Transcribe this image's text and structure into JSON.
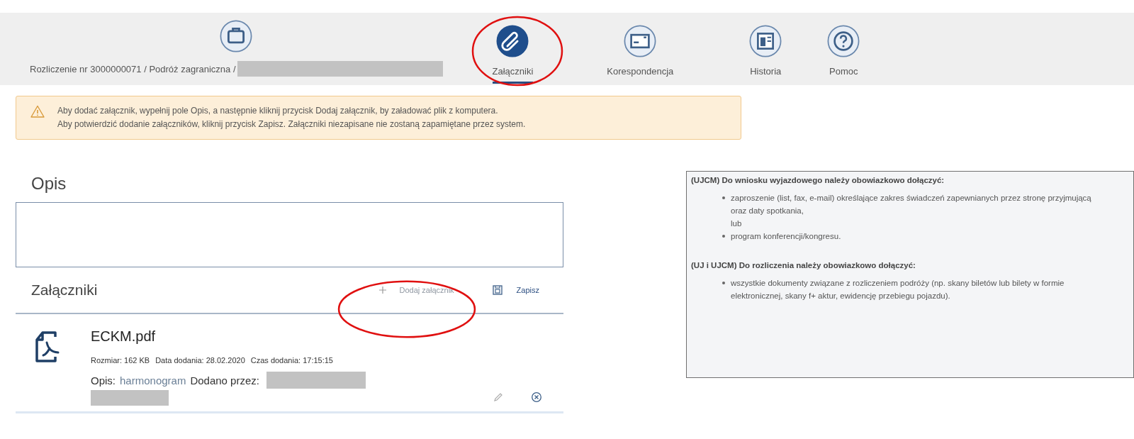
{
  "tabs": [
    {
      "label": "Rozliczenie nr 3000000071 / Podróż zagraniczna /",
      "redacted": true,
      "selected": false
    },
    {
      "label": "Załączniki",
      "redacted": false,
      "selected": true
    },
    {
      "label": "Korespondencja",
      "redacted": false,
      "selected": false
    },
    {
      "label": "Historia",
      "redacted": false,
      "selected": false
    },
    {
      "label": "Pomoc",
      "redacted": false,
      "selected": false
    }
  ],
  "alert": {
    "lines": [
      "Aby dodać załącznik, wypełnij pole Opis, a następnie kliknij przycisk Dodaj załącznik, by załadować plik z komputera.",
      "Aby potwierdzić dodanie załączników, kliknij przycisk Zapisz. Załączniki niezapisane nie zostaną zapamiętane przez system."
    ]
  },
  "description": {
    "label": "Opis"
  },
  "attachments": {
    "title": "Załączniki",
    "add_button": {
      "label": "Dodaj załącznik",
      "disabled": true
    },
    "save_button": {
      "label": "Zapisz"
    },
    "files": [
      {
        "name": "ECKM.pdf",
        "size": "Rozmiar: 162 KB",
        "date": "Data dodania: 28.02.2020",
        "time": "Czas dodania: 17:15:15",
        "desc_label": "Opis:",
        "desc": "harmonogram",
        "added_by_label": "Dodano przez:",
        "added_by_redacted": true
      }
    ]
  },
  "info": {
    "sections": [
      {
        "heading": "(UJCM) Do wniosku wyjazdowego należy obowiazkowo dołączyć:",
        "items": [
          "zaproszenie (list, fax, e-mail) określające zakres świadczeń zapewnianych przez stronę przyjmującą oraz daty spotkania,\nlub",
          "program konferencji/kongresu."
        ]
      },
      {
        "heading": "(UJ i UJCM) Do rozliczenia należy obowiazkowo dołączyć:",
        "items": [
          "wszystkie dokumenty związane z rozliczeniem podróży (np. skany biletów lub bilety w formie elektronicznej, skany f+ aktur, ewidencję przebiegu pojazdu)."
        ]
      }
    ]
  }
}
